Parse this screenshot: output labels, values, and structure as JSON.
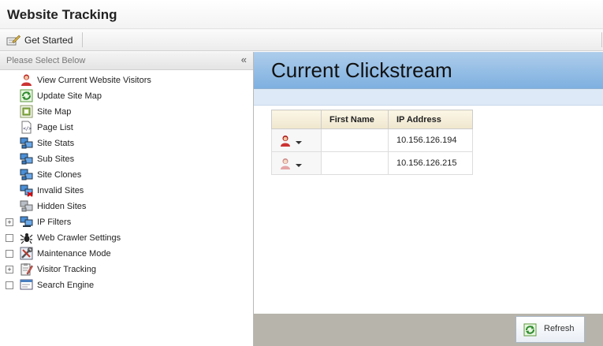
{
  "app": {
    "title": "Website Tracking"
  },
  "toolbar": {
    "get_started_label": "Get Started",
    "icon": "pencil-paper-icon"
  },
  "left_panel": {
    "header": "Please Select Below",
    "collapse_glyph": "«",
    "items": [
      {
        "label": "View Current Website Visitors",
        "icon": "visitor-icon",
        "expander": ""
      },
      {
        "label": "Update Site Map",
        "icon": "refresh-icon",
        "expander": ""
      },
      {
        "label": "Site Map",
        "icon": "sitemap-icon",
        "expander": ""
      },
      {
        "label": "Page List",
        "icon": "page-code-icon",
        "expander": ""
      },
      {
        "label": "Site Stats",
        "icon": "network-icon",
        "expander": ""
      },
      {
        "label": "Sub Sites",
        "icon": "network-icon",
        "expander": ""
      },
      {
        "label": "Site Clones",
        "icon": "network-icon",
        "expander": ""
      },
      {
        "label": "Invalid Sites",
        "icon": "network-error-icon",
        "expander": ""
      },
      {
        "label": "Hidden Sites",
        "icon": "network-hidden-icon",
        "expander": ""
      },
      {
        "label": "IP Filters",
        "icon": "filter-icon",
        "expander": "+"
      },
      {
        "label": "Web Crawler Settings",
        "icon": "spider-icon",
        "expander": " "
      },
      {
        "label": "Maintenance Mode",
        "icon": "tools-icon",
        "expander": " "
      },
      {
        "label": "Visitor Tracking",
        "icon": "clipboard-pen-icon",
        "expander": "+"
      },
      {
        "label": "Search Engine",
        "icon": "search-window-icon",
        "expander": " "
      }
    ]
  },
  "main": {
    "heading": "Current Clickstream",
    "table": {
      "columns": [
        "",
        "First Name",
        "IP Address"
      ],
      "rows": [
        {
          "icon": "visitor-active-icon",
          "first_name": "",
          "ip": "10.156.126.194"
        },
        {
          "icon": "visitor-idle-icon",
          "first_name": "",
          "ip": "10.156.126.215"
        }
      ]
    },
    "refresh_label": "Refresh"
  },
  "colors": {
    "hero_top": "#aecdeb",
    "hero_bottom": "#7eb0e0",
    "footer": "#b7b4ab"
  }
}
